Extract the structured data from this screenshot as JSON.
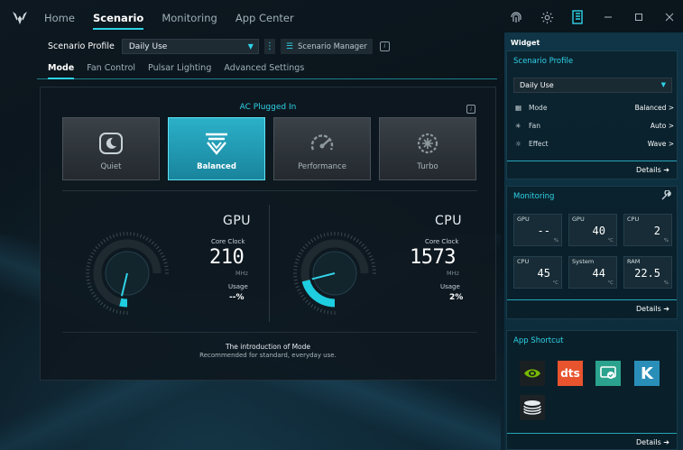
{
  "nav": {
    "items": [
      "Home",
      "Scenario",
      "Monitoring",
      "App Center"
    ],
    "active_index": 1
  },
  "top_icons": [
    "fingerprint-icon",
    "settings-icon",
    "widget-panel-icon",
    "minimize-icon",
    "maximize-icon",
    "close-icon"
  ],
  "scenario": {
    "profile_label": "Scenario Profile",
    "profile_value": "Daily Use",
    "manager_label": "Scenario Manager"
  },
  "subtabs": [
    "Mode",
    "Fan Control",
    "Pulsar Lighting",
    "Advanced Settings"
  ],
  "panel": {
    "power_status": "AC Plugged In",
    "modes": [
      {
        "label": "Quiet",
        "icon": "quiet-mode-icon",
        "active": false
      },
      {
        "label": "Balanced",
        "icon": "balanced-mode-icon",
        "active": true
      },
      {
        "label": "Performance",
        "icon": "performance-mode-icon",
        "active": false
      },
      {
        "label": "Turbo",
        "icon": "turbo-mode-icon",
        "active": false
      }
    ],
    "gpu": {
      "title": "GPU",
      "clock_label": "Core Clock",
      "clock_value": "210",
      "clock_unit": "MHz",
      "usage_label": "Usage",
      "usage_value": "--%",
      "gauge_level": 0.05
    },
    "cpu": {
      "title": "CPU",
      "clock_label": "Core Clock",
      "clock_value": "1573",
      "clock_unit": "MHz",
      "usage_label": "Usage",
      "usage_value": "2%",
      "gauge_level": 0.28
    },
    "intro_title": "The introduction of Mode",
    "intro_desc": "Recommended for standard, everyday use."
  },
  "widget": {
    "title": "Widget",
    "profile": {
      "title": "Scenario Profile",
      "value": "Daily Use",
      "rows": [
        {
          "label": "Mode",
          "value": "Balanced >",
          "icon": "mode-icon"
        },
        {
          "label": "Fan",
          "value": "Auto >",
          "icon": "fan-icon"
        },
        {
          "label": "Effect",
          "value": "Wave >",
          "icon": "effect-icon"
        }
      ],
      "details": "Details ➔"
    },
    "monitoring": {
      "title": "Monitoring",
      "boxes": [
        {
          "label": "GPU",
          "value": "--",
          "unit": "%"
        },
        {
          "label": "GPU",
          "value": "40",
          "unit": "°C"
        },
        {
          "label": "CPU",
          "value": "2",
          "unit": "%"
        },
        {
          "label": "CPU",
          "value": "45",
          "unit": "°C"
        },
        {
          "label": "System",
          "value": "44",
          "unit": "°C"
        },
        {
          "label": "RAM",
          "value": "22.5",
          "unit": "%"
        }
      ],
      "details": "Details ➔"
    },
    "shortcuts": {
      "title": "App Shortcut",
      "apps": [
        "nvidia-icon",
        "dts-icon",
        "screen-share-icon",
        "k-app-icon",
        "storage-app-icon"
      ],
      "dts_text": "dts",
      "k_text": "K",
      "details": "Details ➔"
    }
  },
  "colors": {
    "accent": "#2fd3e8",
    "active_card": "#1f9ab3",
    "sidebar": "#0f3547"
  }
}
